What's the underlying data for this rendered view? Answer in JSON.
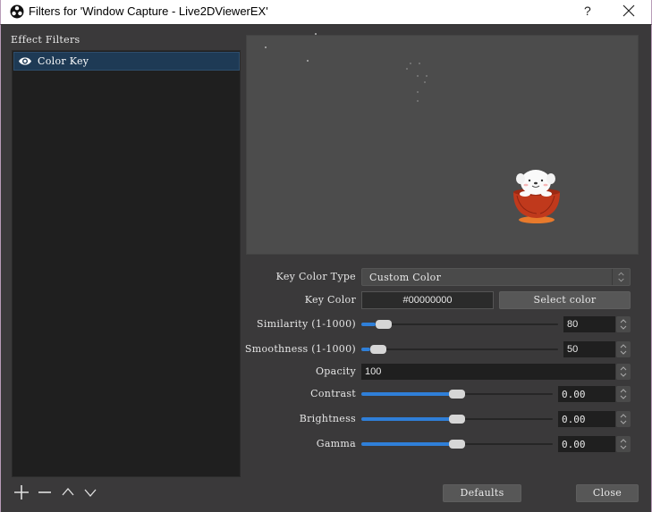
{
  "window": {
    "title": "Filters for 'Window Capture - Live2DViewerEX'",
    "help_label": "?",
    "close_icon": "close-icon",
    "app_icon": "obs-logo-icon"
  },
  "sidebar": {
    "heading": "Effect Filters",
    "filters": [
      {
        "name": "Color Key",
        "visible": true,
        "selected": true,
        "icon": "eye-icon"
      }
    ],
    "toolbar": [
      {
        "icon": "plus-icon",
        "action": "add"
      },
      {
        "icon": "minus-icon",
        "action": "remove"
      },
      {
        "icon": "chevron-up-icon",
        "action": "move-up"
      },
      {
        "icon": "chevron-down-icon",
        "action": "move-down"
      }
    ]
  },
  "properties": {
    "key_color_type": {
      "label": "Key Color Type",
      "value": "Custom Color"
    },
    "key_color": {
      "label": "Key Color",
      "value": "#00000000",
      "button_label": "Select color"
    },
    "similarity": {
      "label": "Similarity (1-1000)",
      "value": "80",
      "min": 1,
      "max": 1000
    },
    "smoothness": {
      "label": "Smoothness (1-1000)",
      "value": "50",
      "min": 1,
      "max": 1000
    },
    "opacity": {
      "label": "Opacity",
      "value": "100"
    },
    "contrast": {
      "label": "Contrast",
      "value": "0.00",
      "fraction": 0.5
    },
    "brightness": {
      "label": "Brightness",
      "value": "0.00",
      "fraction": 0.5
    },
    "gamma": {
      "label": "Gamma",
      "value": "0.00",
      "fraction": 0.5
    }
  },
  "footer": {
    "defaults_label": "Defaults",
    "close_label": "Close"
  },
  "colors": {
    "accent": "#2f7fd8",
    "selection": "#1e3a55",
    "background": "#3a393a"
  }
}
